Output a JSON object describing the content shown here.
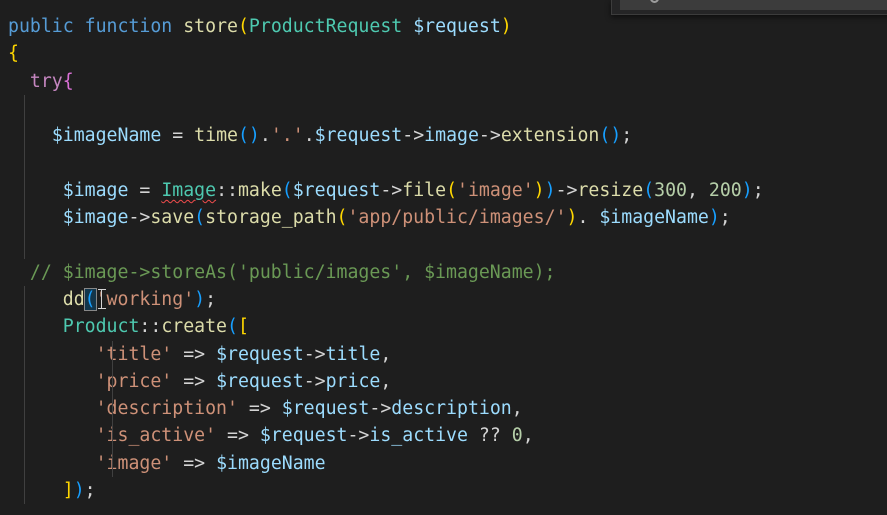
{
  "editor": {
    "lines": [
      {
        "indent": 0,
        "guides": [],
        "tokens": [
          {
            "t": "public",
            "c": "kw"
          },
          {
            "t": " ",
            "c": "op"
          },
          {
            "t": "function",
            "c": "kw"
          },
          {
            "t": " ",
            "c": "op"
          },
          {
            "t": "store",
            "c": "fn"
          },
          {
            "t": "(",
            "c": "b1"
          },
          {
            "t": "ProductRequest",
            "c": "cls"
          },
          {
            "t": " ",
            "c": "op"
          },
          {
            "t": "$request",
            "c": "var"
          },
          {
            "t": ")",
            "c": "b1"
          }
        ]
      },
      {
        "indent": 0,
        "guides": [],
        "tokens": [
          {
            "t": "{",
            "c": "b1"
          }
        ]
      },
      {
        "indent": 2,
        "guides": [],
        "tokens": [
          {
            "t": "try",
            "c": "ctl"
          },
          {
            "t": "{",
            "c": "b2"
          }
        ]
      },
      {
        "indent": 0,
        "guides": [
          1
        ],
        "tokens": []
      },
      {
        "indent": 4,
        "guides": [
          1
        ],
        "tokens": [
          {
            "t": "$imageName",
            "c": "var"
          },
          {
            "t": " = ",
            "c": "op"
          },
          {
            "t": "time",
            "c": "fn"
          },
          {
            "t": "()",
            "c": "b3"
          },
          {
            "t": ".",
            "c": "op"
          },
          {
            "t": "'.'",
            "c": "str"
          },
          {
            "t": ".",
            "c": "op"
          },
          {
            "t": "$request",
            "c": "var"
          },
          {
            "t": "->",
            "c": "op"
          },
          {
            "t": "image",
            "c": "var"
          },
          {
            "t": "->",
            "c": "op"
          },
          {
            "t": "extension",
            "c": "fn"
          },
          {
            "t": "()",
            "c": "b3"
          },
          {
            "t": ";",
            "c": "op"
          }
        ]
      },
      {
        "indent": 0,
        "guides": [
          1
        ],
        "tokens": []
      },
      {
        "indent": 5,
        "guides": [
          1
        ],
        "tokens": [
          {
            "t": "$image",
            "c": "var"
          },
          {
            "t": " = ",
            "c": "op"
          },
          {
            "t": "Image",
            "c": "cls",
            "squig": true
          },
          {
            "t": "::",
            "c": "op"
          },
          {
            "t": "make",
            "c": "fn"
          },
          {
            "t": "(",
            "c": "b3"
          },
          {
            "t": "$request",
            "c": "var"
          },
          {
            "t": "->",
            "c": "op"
          },
          {
            "t": "file",
            "c": "fn"
          },
          {
            "t": "(",
            "c": "b1"
          },
          {
            "t": "'image'",
            "c": "str"
          },
          {
            "t": ")",
            "c": "b1"
          },
          {
            "t": ")",
            "c": "b3"
          },
          {
            "t": "->",
            "c": "op"
          },
          {
            "t": "resize",
            "c": "fn"
          },
          {
            "t": "(",
            "c": "b3"
          },
          {
            "t": "300",
            "c": "num"
          },
          {
            "t": ", ",
            "c": "op"
          },
          {
            "t": "200",
            "c": "num"
          },
          {
            "t": ")",
            "c": "b3"
          },
          {
            "t": ";",
            "c": "op"
          }
        ]
      },
      {
        "indent": 5,
        "guides": [
          1
        ],
        "tokens": [
          {
            "t": "$image",
            "c": "var"
          },
          {
            "t": "->",
            "c": "op"
          },
          {
            "t": "save",
            "c": "fn"
          },
          {
            "t": "(",
            "c": "b3"
          },
          {
            "t": "storage_path",
            "c": "fn"
          },
          {
            "t": "(",
            "c": "b1"
          },
          {
            "t": "'app/public/images/'",
            "c": "str"
          },
          {
            "t": ")",
            "c": "b1"
          },
          {
            "t": ". ",
            "c": "op"
          },
          {
            "t": "$imageName",
            "c": "var"
          },
          {
            "t": ")",
            "c": "b3"
          },
          {
            "t": ";",
            "c": "op"
          }
        ]
      },
      {
        "indent": 0,
        "guides": [
          1
        ],
        "tokens": []
      },
      {
        "indent": 2,
        "guides": [],
        "tokens": [
          {
            "t": "// $image->storeAs('public/images', $imageName);",
            "c": "cmt"
          }
        ]
      },
      {
        "indent": 5,
        "guides": [
          1
        ],
        "cursorAt": 8,
        "tokens": [
          {
            "t": "dd",
            "c": "fn"
          },
          {
            "t": "(",
            "c": "b3",
            "match": true
          },
          {
            "t": "'working'",
            "c": "str"
          },
          {
            "t": ")",
            "c": "b3"
          },
          {
            "t": ";",
            "c": "op"
          }
        ]
      },
      {
        "indent": 5,
        "guides": [
          1
        ],
        "tokens": [
          {
            "t": "Product",
            "c": "cls"
          },
          {
            "t": "::",
            "c": "op"
          },
          {
            "t": "create",
            "c": "fn"
          },
          {
            "t": "(",
            "c": "b3"
          },
          {
            "t": "[",
            "c": "b1"
          }
        ]
      },
      {
        "indent": 8,
        "guides": [
          1,
          5
        ],
        "tokens": [
          {
            "t": "'title'",
            "c": "str"
          },
          {
            "t": " => ",
            "c": "op"
          },
          {
            "t": "$request",
            "c": "var"
          },
          {
            "t": "->",
            "c": "op"
          },
          {
            "t": "title",
            "c": "var"
          },
          {
            "t": ",",
            "c": "op"
          }
        ]
      },
      {
        "indent": 8,
        "guides": [
          1,
          5
        ],
        "tokens": [
          {
            "t": "'price'",
            "c": "str"
          },
          {
            "t": " => ",
            "c": "op"
          },
          {
            "t": "$request",
            "c": "var"
          },
          {
            "t": "->",
            "c": "op"
          },
          {
            "t": "price",
            "c": "var"
          },
          {
            "t": ",",
            "c": "op"
          }
        ]
      },
      {
        "indent": 8,
        "guides": [
          1,
          5
        ],
        "tokens": [
          {
            "t": "'description'",
            "c": "str"
          },
          {
            "t": " => ",
            "c": "op"
          },
          {
            "t": "$request",
            "c": "var"
          },
          {
            "t": "->",
            "c": "op"
          },
          {
            "t": "description",
            "c": "var"
          },
          {
            "t": ",",
            "c": "op"
          }
        ]
      },
      {
        "indent": 8,
        "guides": [
          1,
          5
        ],
        "tokens": [
          {
            "t": "'is_active'",
            "c": "str"
          },
          {
            "t": " => ",
            "c": "op"
          },
          {
            "t": "$request",
            "c": "var"
          },
          {
            "t": "->",
            "c": "op"
          },
          {
            "t": "is_active",
            "c": "var"
          },
          {
            "t": " ?? ",
            "c": "op"
          },
          {
            "t": "0",
            "c": "num"
          },
          {
            "t": ",",
            "c": "op"
          }
        ]
      },
      {
        "indent": 8,
        "guides": [
          1,
          5
        ],
        "tokens": [
          {
            "t": "'image'",
            "c": "str"
          },
          {
            "t": " => ",
            "c": "op"
          },
          {
            "t": "$imageName",
            "c": "var"
          }
        ]
      },
      {
        "indent": 5,
        "guides": [
          1
        ],
        "tokens": [
          {
            "t": "]",
            "c": "b1"
          },
          {
            "t": ")",
            "c": "b3"
          },
          {
            "t": ";",
            "c": "op"
          }
        ]
      }
    ]
  }
}
